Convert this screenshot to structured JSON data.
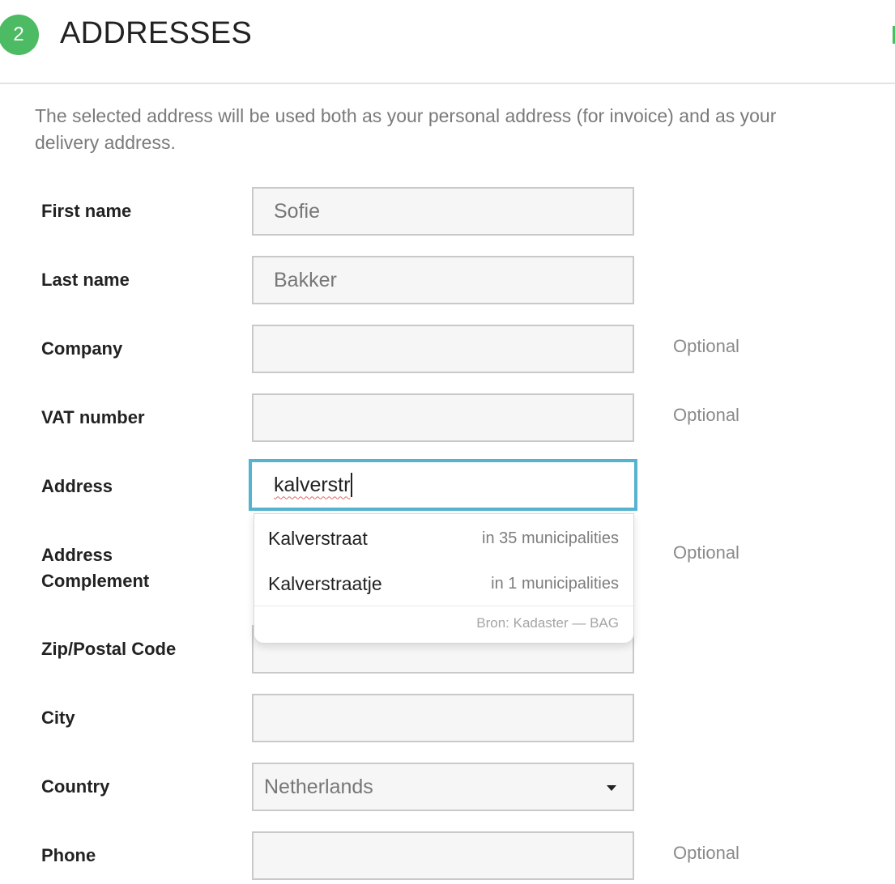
{
  "header": {
    "step_number": "2",
    "title": "ADDRESSES"
  },
  "intro": "The selected address will be used both as your personal address (for invoice) and as your delivery address.",
  "optional_label": "Optional",
  "form": {
    "first_name": {
      "label": "First name",
      "value": "Sofie"
    },
    "last_name": {
      "label": "Last name",
      "value": "Bakker"
    },
    "company": {
      "label": "Company",
      "value": ""
    },
    "vat_number": {
      "label": "VAT number",
      "value": ""
    },
    "address": {
      "label": "Address",
      "value": "kalverstr"
    },
    "address_complement": {
      "label_line1": "Address",
      "label_line2": "Complement",
      "value": ""
    },
    "zip": {
      "label": "Zip/Postal Code",
      "value": ""
    },
    "city": {
      "label": "City",
      "value": ""
    },
    "country": {
      "label": "Country",
      "value": "Netherlands"
    },
    "phone": {
      "label": "Phone",
      "value": ""
    }
  },
  "autocomplete": {
    "suggestions": [
      {
        "name": "Kalverstraat",
        "meta": "in 35 municipalities"
      },
      {
        "name": "Kalverstraatje",
        "meta": "in 1 municipalities"
      }
    ],
    "source": "Bron: Kadaster — BAG"
  },
  "colors": {
    "accent_green": "#4dbb63",
    "focus_blue": "#56b3d0"
  },
  "icons": {
    "select_caret": "caret-down-icon"
  }
}
